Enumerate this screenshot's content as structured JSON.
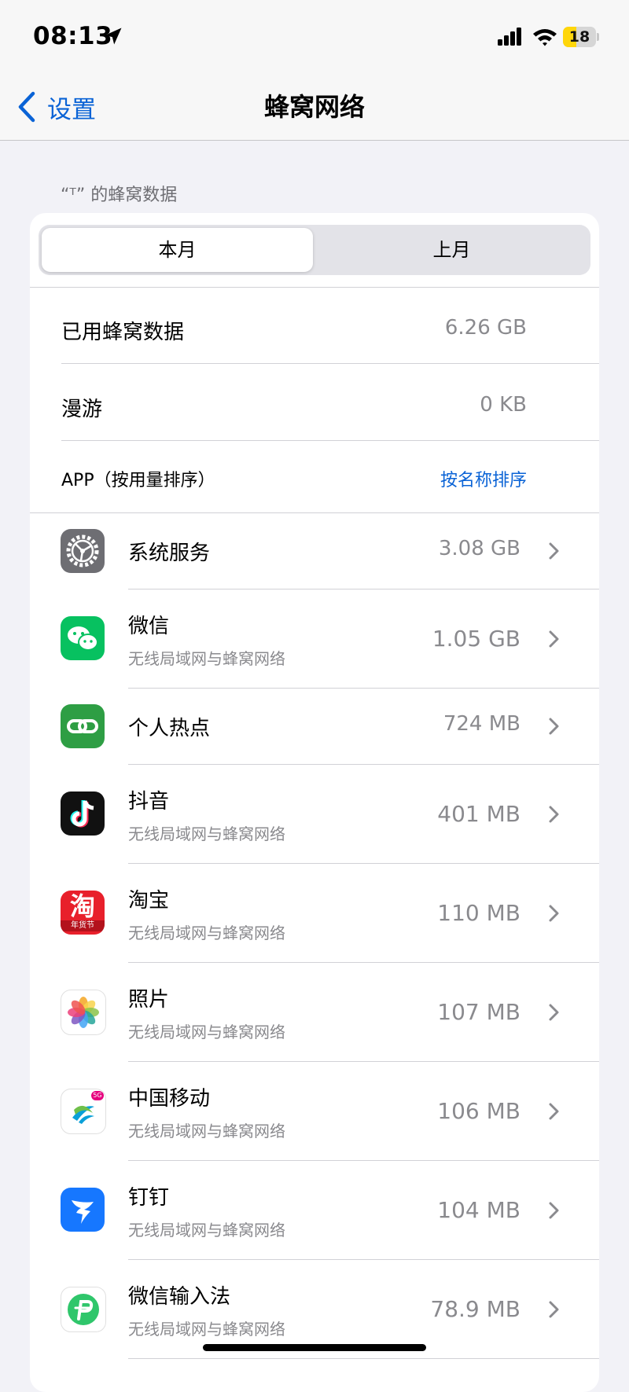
{
  "status_bar": {
    "time": "08:13",
    "battery": "18",
    "battery_level": 0.18
  },
  "nav": {
    "back_label": "设置",
    "title": "蜂窝网络"
  },
  "section_header": "“ᵀ” 的蜂窝数据",
  "segments": {
    "current": "本月",
    "last": "上月"
  },
  "usage": {
    "used_label": "已用蜂窝数据",
    "used_value": "6.26 GB",
    "roaming_label": "漫游",
    "roaming_value": "0 KB"
  },
  "apps_header": {
    "label": "APP（按用量排序）",
    "sort_link": "按名称排序"
  },
  "apps": [
    {
      "name": "系统服务",
      "subtitle": "",
      "value": "3.08 GB",
      "icon": "system-services-gear-icon"
    },
    {
      "name": "微信",
      "subtitle": "无线局域网与蜂窝网络",
      "value": "1.05 GB",
      "icon": "wechat-icon"
    },
    {
      "name": "个人热点",
      "subtitle": "",
      "value": "724 MB",
      "icon": "hotspot-link-icon"
    },
    {
      "name": "抖音",
      "subtitle": "无线局域网与蜂窝网络",
      "value": "401 MB",
      "icon": "douyin-note-icon"
    },
    {
      "name": "淘宝",
      "subtitle": "无线局域网与蜂窝网络",
      "value": "110 MB",
      "icon": "taobao-icon",
      "icon_text": "淘",
      "icon_badge": "年货节"
    },
    {
      "name": "照片",
      "subtitle": "无线局域网与蜂窝网络",
      "value": "107 MB",
      "icon": "photos-flower-icon"
    },
    {
      "name": "中国移动",
      "subtitle": "无线局域网与蜂窝网络",
      "value": "106 MB",
      "icon": "china-mobile-icon",
      "icon_badge": "5G"
    },
    {
      "name": "钉钉",
      "subtitle": "无线局域网与蜂窝网络",
      "value": "104 MB",
      "icon": "dingtalk-wing-icon"
    },
    {
      "name": "微信输入法",
      "subtitle": "无线局域网与蜂窝网络",
      "value": "78.9 MB",
      "icon": "wechat-input-icon"
    }
  ],
  "colors": {
    "accent": "#0a63d6",
    "background": "#f2f2f7",
    "secondary_text": "#8a8a8e",
    "battery": "#ffd60a"
  }
}
